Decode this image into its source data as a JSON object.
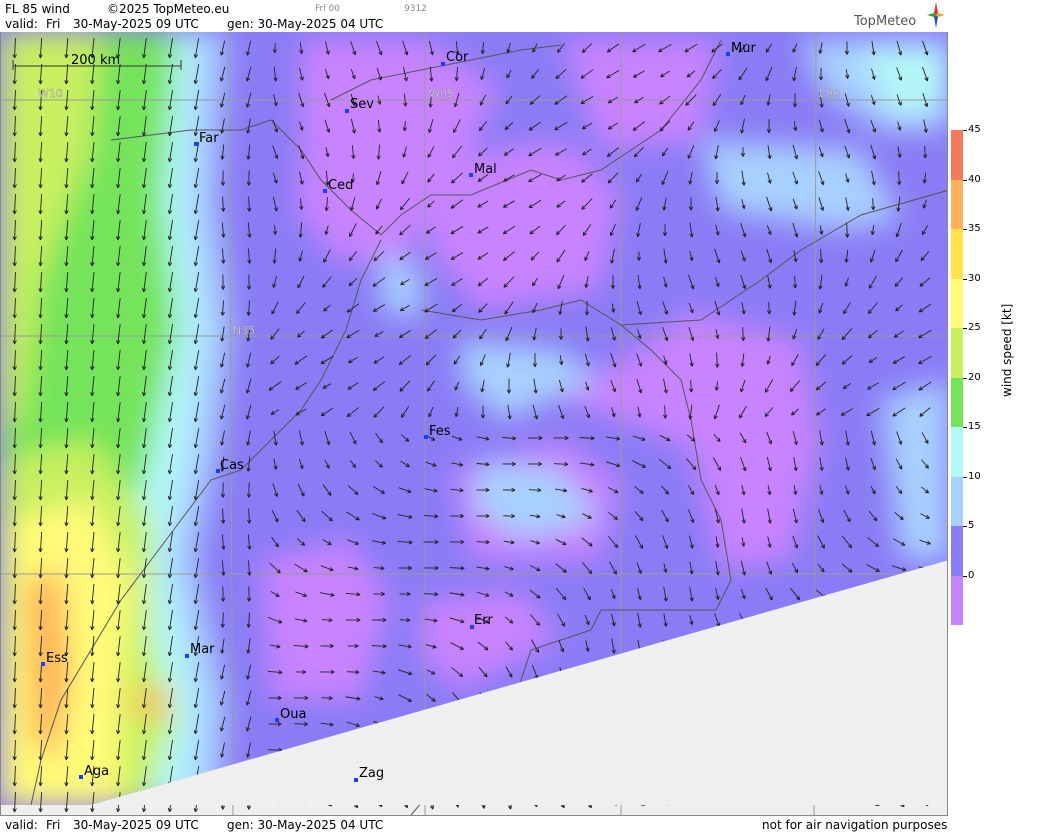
{
  "header": {
    "product": "FL 85 wind",
    "copyright": "©2025 TopMeteo.eu",
    "run": "Fri 00",
    "code": "9312",
    "valid_label": "valid:",
    "valid_day": "Fri",
    "valid_time": "30-May-2025  09 UTC",
    "gen": "gen: 30-May-2025 04 UTC",
    "logo": "TopMeteo"
  },
  "footer": {
    "valid_label": "valid:",
    "valid_day": "Fri",
    "valid_time": "30-May-2025  09 UTC",
    "gen": "gen: 30-May-2025 04 UTC",
    "disclaimer": "not for air navigation purposes"
  },
  "map": {
    "scale_label": "200 km",
    "grid_labels": [
      "W10",
      "W05",
      "E00",
      "N35"
    ],
    "cities": [
      "Cor",
      "Mur",
      "Sev",
      "Far",
      "Mal",
      "Ced",
      "Cas",
      "Fes",
      "Err",
      "Mar",
      "Ess",
      "Oua",
      "Aga",
      "Zag"
    ]
  },
  "colorbar": {
    "title": "wind speed [kt]",
    "ticks": [
      "45",
      "40",
      "35",
      "30",
      "25",
      "20",
      "15",
      "10",
      "5",
      "0"
    ],
    "colors": [
      "#f07a5a",
      "#ffb05a",
      "#ffe24a",
      "#fffb78",
      "#c8f060",
      "#74e45a",
      "#b4f8f8",
      "#a8d0ff",
      "#8a7cf5",
      "#c883ff"
    ]
  }
}
